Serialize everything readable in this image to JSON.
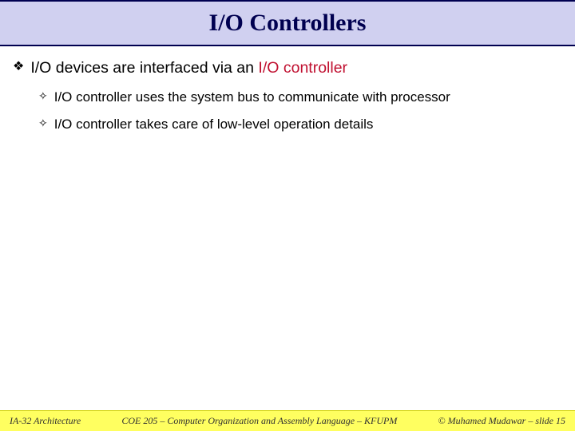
{
  "title": "I/O Controllers",
  "main_bullet": {
    "prefix": "I/O devices are interfaced via an ",
    "highlight": "I/O controller"
  },
  "sub_bullets": [
    "I/O controller uses the system bus to communicate with processor",
    "I/O controller takes care of low-level operation details"
  ],
  "footer": {
    "left": "IA-32 Architecture",
    "center": "COE 205 – Computer Organization and Assembly Language – KFUPM",
    "right": "© Muhamed Mudawar – slide 15"
  }
}
